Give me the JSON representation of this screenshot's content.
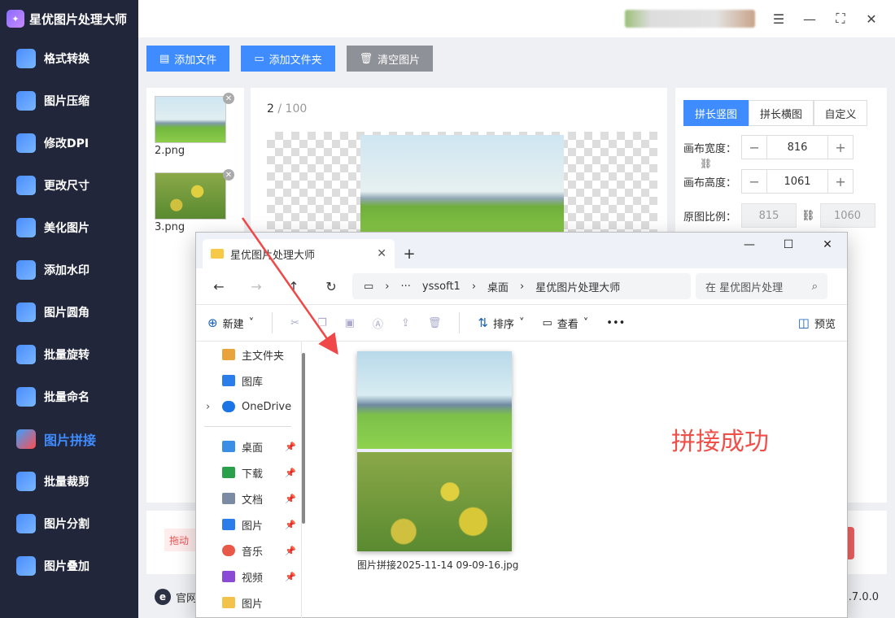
{
  "app": {
    "title": "星优图片处理大师",
    "logo_char": "✦"
  },
  "sidebar": {
    "items": [
      {
        "label": "格式转换"
      },
      {
        "label": "图片压缩"
      },
      {
        "label": "修改DPI"
      },
      {
        "label": "更改尺寸"
      },
      {
        "label": "美化图片"
      },
      {
        "label": "添加水印"
      },
      {
        "label": "图片圆角"
      },
      {
        "label": "批量旋转"
      },
      {
        "label": "批量命名"
      },
      {
        "label": "图片拼接",
        "active": true
      },
      {
        "label": "批量裁剪"
      },
      {
        "label": "图片分割"
      },
      {
        "label": "图片叠加"
      }
    ]
  },
  "toolbar": {
    "add_file": "添加文件",
    "add_folder": "添加文件夹",
    "clear": "清空图片"
  },
  "thumbs": [
    {
      "name": "2.png"
    },
    {
      "name": "3.png"
    }
  ],
  "preview": {
    "current": "2",
    "total": "/ 100"
  },
  "settings": {
    "tabs": [
      "拼长竖图",
      "拼长横图",
      "自定义"
    ],
    "canvas_width_label": "画布宽度：",
    "canvas_width": "816",
    "canvas_height_label": "画布高度：",
    "canvas_height": "1061",
    "ratio_label": "原图比例：",
    "ratio_w": "815",
    "ratio_h": "1060"
  },
  "bottom": {
    "hint": "拖动"
  },
  "footer": {
    "site": "官网",
    "version": "1.7.0.0"
  },
  "explorer": {
    "tab_title": "星优图片处理大师",
    "path": [
      "yssoft1",
      "桌面",
      "星优图片处理大师"
    ],
    "search_placeholder": "在 星优图片处理",
    "cmd": {
      "new": "新建",
      "sort": "排序",
      "view": "查看",
      "preview": "预览"
    },
    "sidebar": [
      {
        "label": "主文件夹",
        "color": "#e8a33d"
      },
      {
        "label": "图库",
        "color": "#2b7de9"
      },
      {
        "label": "OneDrive",
        "color": "#1b74e4"
      }
    ],
    "sidebar_pinned": [
      {
        "label": "桌面",
        "color": "#3a8ee6"
      },
      {
        "label": "下载",
        "color": "#2aa04a"
      },
      {
        "label": "文档",
        "color": "#7a8ba3"
      },
      {
        "label": "图片",
        "color": "#2b7de9"
      },
      {
        "label": "音乐",
        "color": "#e8594a"
      },
      {
        "label": "视频",
        "color": "#8a4ad6"
      },
      {
        "label": "图片",
        "color": "#f2c24a"
      }
    ],
    "file_name": "图片拼接2025-11-14 09-09-16.jpg",
    "success_text": "拼接成功"
  },
  "colors": {
    "accent": "#3e8cff",
    "sidebar_bg": "#22263a",
    "success": "#f0504a"
  }
}
